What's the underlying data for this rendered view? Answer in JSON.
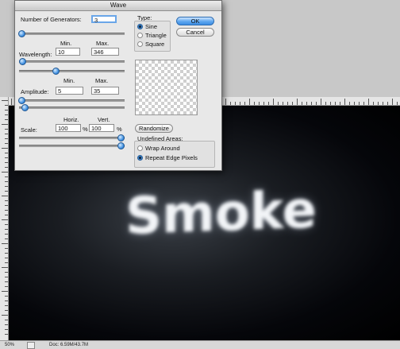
{
  "dialog": {
    "title": "Wave",
    "generators_label": "Number of Generators:",
    "generators_value": "3",
    "min_header": "Min.",
    "max_header": "Max.",
    "wavelength_label": "Wavelength:",
    "wavelength_min": "10",
    "wavelength_max": "346",
    "amplitude_label": "Amplitude:",
    "amplitude_min": "5",
    "amplitude_max": "35",
    "scale_label": "Scale:",
    "horiz_header": "Horiz.",
    "vert_header": "Vert.",
    "scale_horiz": "100",
    "scale_vert": "100",
    "percent_sign": "%",
    "type_label": "Type:",
    "type_options": [
      "Sine",
      "Triangle",
      "Square"
    ],
    "selected_type": "Sine",
    "ok_label": "OK",
    "cancel_label": "Cancel",
    "randomize_label": "Randomize",
    "undefined_areas_label": "Undefined Areas:",
    "undefined_options": [
      "Wrap Around",
      "Repeat Edge Pixels"
    ],
    "selected_undefined": "Repeat Edge Pixels"
  },
  "canvas": {
    "text": "Smoke"
  },
  "status": {
    "zoom": "50%",
    "doc_size": "Doc: 6.59M/43.7M"
  },
  "colors": {
    "accent": "#3d8ee3",
    "canvas_bg": "#000000"
  }
}
